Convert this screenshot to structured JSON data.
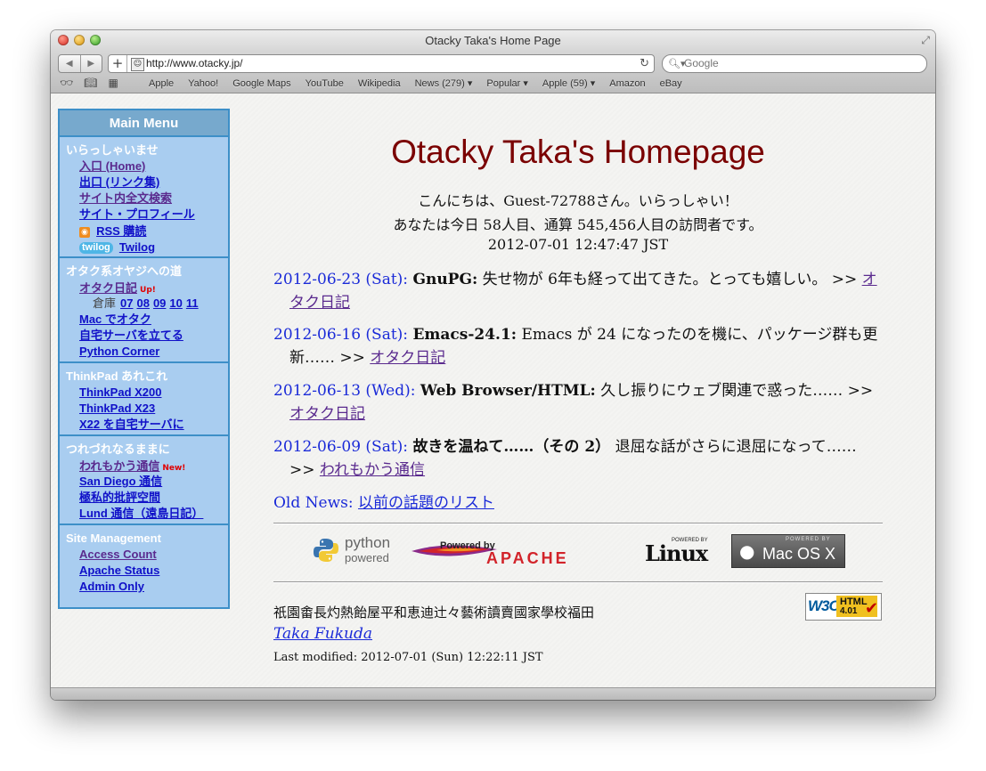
{
  "window": {
    "title": "Otacky Taka's Home Page"
  },
  "toolbar": {
    "url": "http://www.otacky.jp/",
    "search_placeholder": "Google"
  },
  "bookmarks": [
    "Apple",
    "Yahoo!",
    "Google Maps",
    "YouTube",
    "Wikipedia",
    "News (279) ▾",
    "Popular ▾",
    "Apple (59) ▾",
    "Amazon",
    "eBay"
  ],
  "menu": {
    "title": "Main Menu",
    "sections": [
      {
        "title": "いらっしゃいませ",
        "items": [
          "入口 (Home)",
          "出口 (リンク集)",
          "サイト内全文検索",
          "サイト・プロフィール",
          "RSS 購読",
          "Twilog"
        ]
      },
      {
        "title": "オタク系オヤジへの道",
        "items": [
          "オタク日記",
          "Mac でオタク",
          "自宅サーバを立てる",
          "Python Corner"
        ],
        "badge_up": "Up!",
        "souko_label": "倉庫",
        "souko_links": [
          "07",
          "08",
          "09",
          "10",
          "11"
        ]
      },
      {
        "title": "ThinkPad あれこれ",
        "items": [
          "ThinkPad X200",
          "ThinkPad X23",
          "X22 を自宅サーバに"
        ]
      },
      {
        "title": "つれづれなるままに",
        "items": [
          "われもかう通信",
          "San Diego 通信",
          "極私的批評空間",
          "Lund 通信（遠島日記）"
        ],
        "badge_new": "New!"
      },
      {
        "title": "Site Management",
        "items": [
          "Access Count",
          "Apache Status",
          "Admin Only"
        ]
      }
    ]
  },
  "main": {
    "title": "Otacky Taka's Homepage",
    "greeting1": "こんにちは、Guest-72788さん。いらっしゃい！",
    "greeting2": "あなたは今日 58人目、通算 545,456人目の訪問者です。",
    "datetime": "2012-07-01 12:47:47 JST",
    "news": [
      {
        "date": "2012-06-23 (Sat):",
        "title": "GnuPG:",
        "text": " 失せ物が 6年も経って出てきた。とっても嬉しい。 >> ",
        "link": "オタク日記"
      },
      {
        "date": "2012-06-16 (Sat):",
        "title": "Emacs-24.1:",
        "text": " Emacs が 24 になったのを機に、パッケージ群も更新…… >> ",
        "link": "オタク日記"
      },
      {
        "date": "2012-06-13 (Wed):",
        "title": "Web Browser/HTML:",
        "text": " 久し振りにウェブ関連で惑った…… >> ",
        "link": "オタク日記"
      },
      {
        "date": "2012-06-09 (Sat):",
        "title": "故きを温ねて……（その 2）",
        "text": " 退屈な話がさらに退屈になって…… >> ",
        "link": "われもかう通信"
      }
    ],
    "old_news_label": "Old News:",
    "old_news_link": "以前の話題のリスト",
    "logos": {
      "python_1": "python",
      "python_2": "powered",
      "apache_1": "Powered by",
      "apache_2": "APACHE",
      "linux_1": "POWERED BY",
      "linux_2": "Linux",
      "mac_1": "POWERED BY",
      "mac_2": "Mac OS X"
    },
    "footer_chars": "祇園畬長灼熱飴屋平和恵迪辻々藝術讀賣國家學校福田",
    "author": "Taka Fukuda",
    "last_modified": "Last modified: 2012-07-01 (Sun) 12:22:11 JST",
    "w3c": {
      "left": "W3C",
      "right1": "HTML",
      "right2": "4.01"
    }
  }
}
